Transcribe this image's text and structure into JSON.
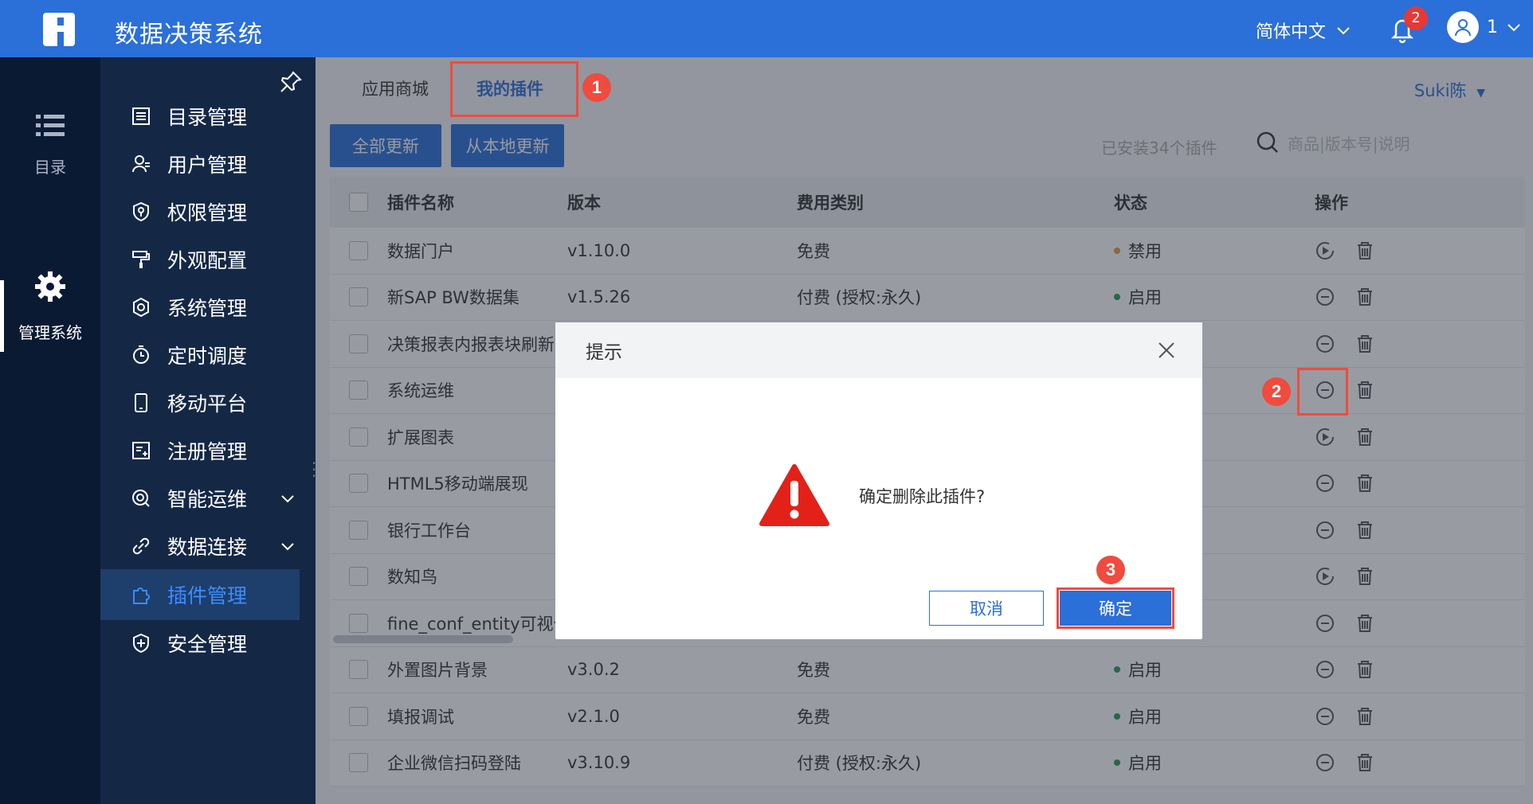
{
  "app": {
    "title": "数据决策系统",
    "language": "简体中文",
    "notification_count": "2",
    "user_name": "1"
  },
  "rail": {
    "items": [
      {
        "label": "目录",
        "icon": "list-icon"
      },
      {
        "label": "管理系统",
        "icon": "gear-icon"
      }
    ]
  },
  "sidebar": {
    "items": [
      {
        "label": "目录管理",
        "icon": "catalog-icon"
      },
      {
        "label": "用户管理",
        "icon": "user-icon"
      },
      {
        "label": "权限管理",
        "icon": "shield-key-icon"
      },
      {
        "label": "外观配置",
        "icon": "paint-roller-icon"
      },
      {
        "label": "系统管理",
        "icon": "settings-icon"
      },
      {
        "label": "定时调度",
        "icon": "timer-icon"
      },
      {
        "label": "移动平台",
        "icon": "mobile-icon"
      },
      {
        "label": "注册管理",
        "icon": "register-icon"
      },
      {
        "label": "智能运维",
        "icon": "ops-icon"
      },
      {
        "label": "数据连接",
        "icon": "link-icon"
      },
      {
        "label": "插件管理",
        "icon": "plugin-icon"
      },
      {
        "label": "安全管理",
        "icon": "security-icon"
      }
    ]
  },
  "main": {
    "tabs": [
      {
        "label": "应用商城"
      },
      {
        "label": "我的插件"
      }
    ],
    "selected_user": "Suki陈",
    "update_all_label": "全部更新",
    "update_local_label": "从本地更新",
    "installed_count": "已安装34个插件",
    "search_placeholder": "商品|版本号|说明",
    "columns": {
      "name": "插件名称",
      "version": "版本",
      "fee": "费用类别",
      "status": "状态",
      "ops": "操作"
    },
    "rows": [
      {
        "name": "数据门户",
        "version": "v1.10.0",
        "fee": "免费",
        "status": "禁用",
        "status_color": "#e0a13a",
        "op": "enable"
      },
      {
        "name": "新SAP BW数据集",
        "version": "v1.5.26",
        "fee": "付费 (授权:永久)",
        "status": "启用",
        "status_color": "#2a9d4b",
        "op": "disable"
      },
      {
        "name": "决策报表内报表块刷新",
        "version": "",
        "fee": "",
        "status": "",
        "status_color": "",
        "op": "disable"
      },
      {
        "name": "系统运维",
        "version": "",
        "fee": "",
        "status": "",
        "status_color": "",
        "op": "disable"
      },
      {
        "name": "扩展图表",
        "version": "",
        "fee": "",
        "status": "",
        "status_color": "",
        "op": "enable"
      },
      {
        "name": "HTML5移动端展现",
        "version": "",
        "fee": "",
        "status": "",
        "status_color": "",
        "op": "disable"
      },
      {
        "name": "银行工作台",
        "version": "",
        "fee": "",
        "status": "",
        "status_color": "",
        "op": "disable"
      },
      {
        "name": "数知鸟",
        "version": "",
        "fee": "",
        "status": "",
        "status_color": "",
        "op": "enable"
      },
      {
        "name": "fine_conf_entity可视化",
        "version": "",
        "fee": "",
        "status": "",
        "status_color": "",
        "op": "disable"
      },
      {
        "name": "外置图片背景",
        "version": "v3.0.2",
        "fee": "免费",
        "status": "启用",
        "status_color": "#2a9d4b",
        "op": "disable"
      },
      {
        "name": "填报调试",
        "version": "v2.1.0",
        "fee": "免费",
        "status": "启用",
        "status_color": "#2a9d4b",
        "op": "disable"
      },
      {
        "name": "企业微信扫码登陆",
        "version": "v3.10.9",
        "fee": "付费 (授权:永久)",
        "status": "启用",
        "status_color": "#2a9d4b",
        "op": "disable"
      }
    ]
  },
  "dialog": {
    "title": "提示",
    "message": "确定删除此插件?",
    "cancel_label": "取消",
    "ok_label": "确定"
  },
  "annotations": {
    "n1": "1",
    "n2": "2",
    "n3": "3"
  },
  "colors": {
    "primary": "#2b6fd8",
    "annotation": "#ef4b3f",
    "sidebar_bg": "#142846",
    "rail_bg": "#0b1a33"
  }
}
